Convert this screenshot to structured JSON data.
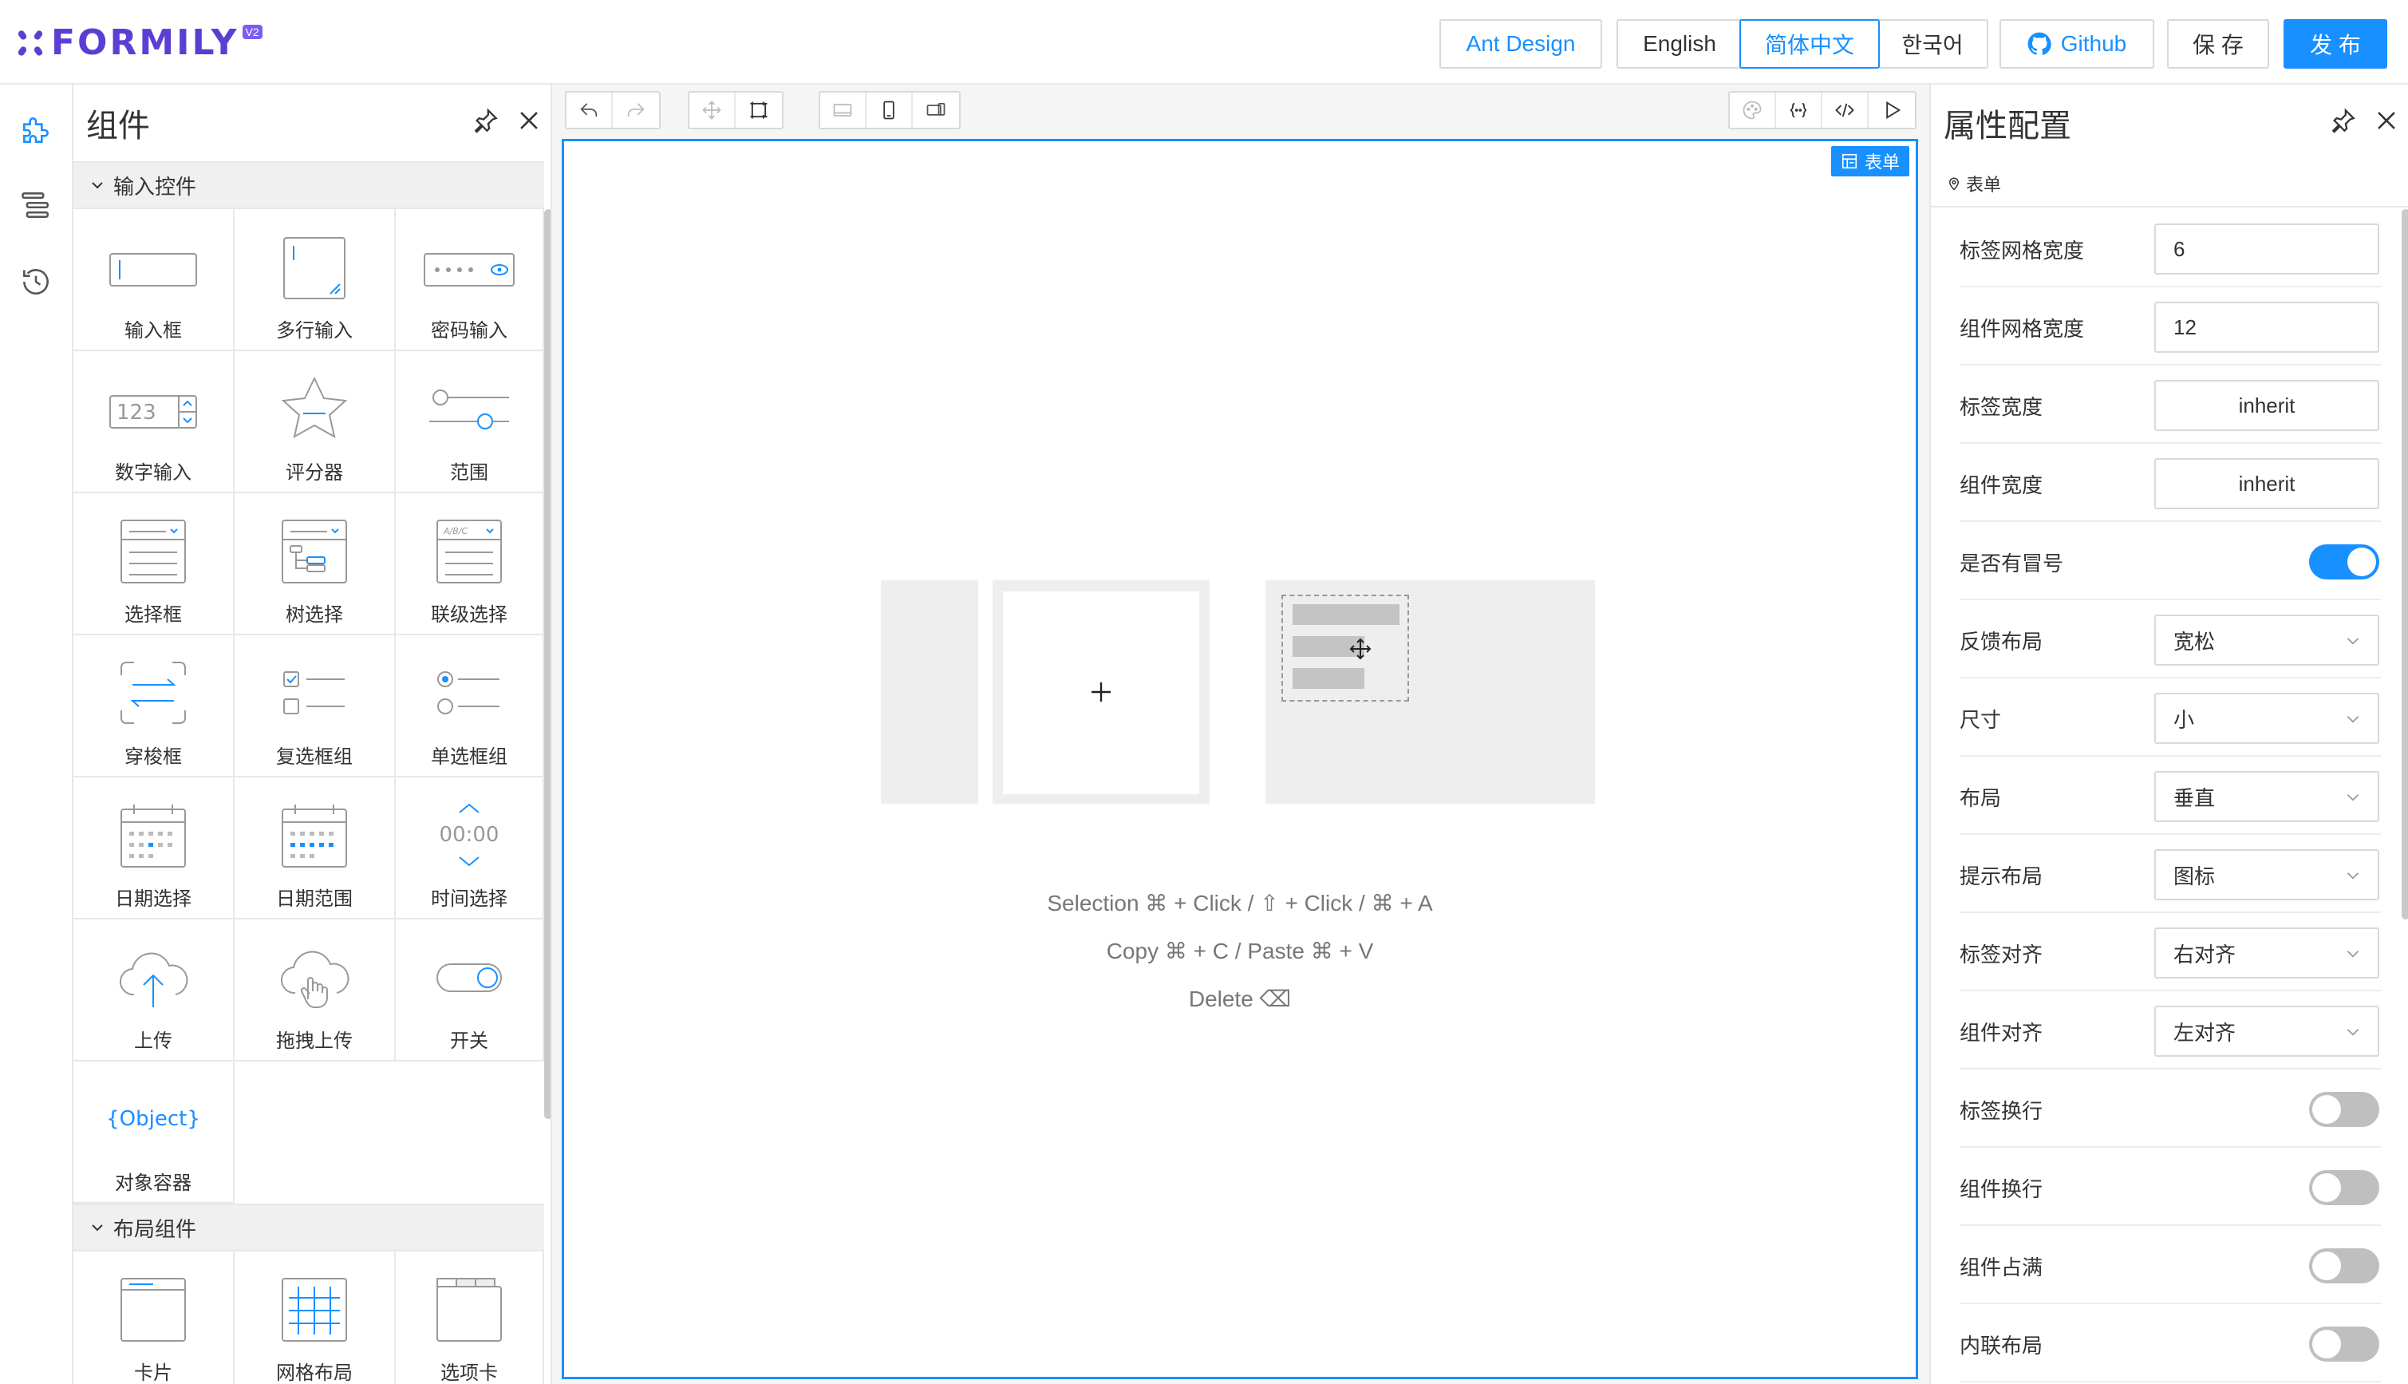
{
  "header": {
    "logo_text": "FORMILY",
    "logo_badge": "V2",
    "buttons": {
      "ant_design": "Ant Design",
      "english": "English",
      "chinese": "简体中文",
      "korean": "한국어",
      "github": "Github",
      "save": "保 存",
      "publish": "发 布"
    }
  },
  "rail": {
    "items": [
      {
        "icon": "puzzle-icon",
        "active": true
      },
      {
        "icon": "outline-tree-icon",
        "active": false
      },
      {
        "icon": "history-icon",
        "active": false
      }
    ]
  },
  "components_panel": {
    "title": "组件",
    "groups": [
      {
        "title": "输入控件",
        "items": [
          {
            "label": "输入框",
            "icon": "input-icon"
          },
          {
            "label": "多行输入",
            "icon": "textarea-icon"
          },
          {
            "label": "密码输入",
            "icon": "password-icon"
          },
          {
            "label": "数字输入",
            "icon": "number-input-icon"
          },
          {
            "label": "评分器",
            "icon": "rate-icon"
          },
          {
            "label": "范围",
            "icon": "slider-icon"
          },
          {
            "label": "选择框",
            "icon": "select-icon"
          },
          {
            "label": "树选择",
            "icon": "tree-select-icon"
          },
          {
            "label": "联级选择",
            "icon": "cascader-icon"
          },
          {
            "label": "穿梭框",
            "icon": "transfer-icon"
          },
          {
            "label": "复选框组",
            "icon": "checkbox-group-icon"
          },
          {
            "label": "单选框组",
            "icon": "radio-group-icon"
          },
          {
            "label": "日期选择",
            "icon": "date-picker-icon"
          },
          {
            "label": "日期范围",
            "icon": "date-range-icon"
          },
          {
            "label": "时间选择",
            "icon": "time-picker-icon"
          },
          {
            "label": "上传",
            "icon": "upload-icon"
          },
          {
            "label": "拖拽上传",
            "icon": "drag-upload-icon"
          },
          {
            "label": "开关",
            "icon": "switch-icon"
          },
          {
            "label": "对象容器",
            "icon": "object-container-icon"
          }
        ]
      },
      {
        "title": "布局组件",
        "items": [
          {
            "label": "卡片",
            "icon": "card-icon"
          },
          {
            "label": "网格布局",
            "icon": "grid-icon"
          },
          {
            "label": "选项卡",
            "icon": "tabs-icon"
          }
        ]
      }
    ]
  },
  "canvas": {
    "form_tag": "表单",
    "hints": {
      "selection": "Selection ⌘ + Click / ⇧ + Click / ⌘ + A",
      "copy": "Copy ⌘ + C / Paste ⌘ + V",
      "delete": "Delete ⌫"
    }
  },
  "properties_panel": {
    "title": "属性配置",
    "breadcrumb": "表单",
    "rows": [
      {
        "label": "标签网格宽度",
        "type": "input",
        "value": "6"
      },
      {
        "label": "组件网格宽度",
        "type": "input",
        "value": "12"
      },
      {
        "label": "标签宽度",
        "type": "input-center",
        "value": "inherit"
      },
      {
        "label": "组件宽度",
        "type": "input-center",
        "value": "inherit"
      },
      {
        "label": "是否有冒号",
        "type": "switch",
        "value": true
      },
      {
        "label": "反馈布局",
        "type": "select",
        "value": "宽松"
      },
      {
        "label": "尺寸",
        "type": "select",
        "value": "小"
      },
      {
        "label": "布局",
        "type": "select",
        "value": "垂直"
      },
      {
        "label": "提示布局",
        "type": "select",
        "value": "图标"
      },
      {
        "label": "标签对齐",
        "type": "select",
        "value": "右对齐"
      },
      {
        "label": "组件对齐",
        "type": "select",
        "value": "左对齐"
      },
      {
        "label": "标签换行",
        "type": "switch",
        "value": false
      },
      {
        "label": "组件换行",
        "type": "switch",
        "value": false
      },
      {
        "label": "组件占满",
        "type": "switch",
        "value": false
      },
      {
        "label": "内联布局",
        "type": "switch",
        "value": false
      }
    ]
  },
  "colors": {
    "primary": "#1890ff",
    "logo": "#5b3fd3",
    "placeholder": "#eeeeee"
  }
}
